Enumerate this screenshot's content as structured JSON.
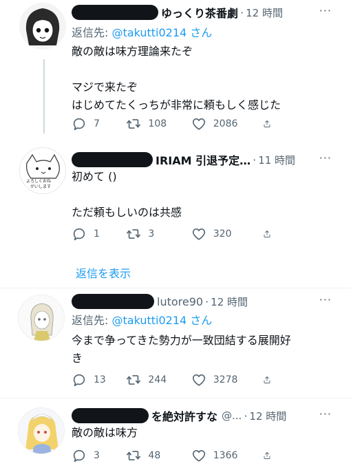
{
  "tweets": [
    {
      "name": "ゆっくり茶番劇",
      "handle": "",
      "time": "12 時間",
      "more": "···",
      "reply_to_label": "返信先:",
      "reply_to_handle": "@takutti0214 さん",
      "body": [
        "敵の敵は味方理論来たぞ",
        "マジで来たぞ",
        "はじめてたくっちが非常に頼もしく感じた"
      ],
      "replies": "7",
      "retweets": "108",
      "likes": "2086"
    },
    {
      "name": "IRIAM 引退予定…",
      "handle": "",
      "time": "11 時間",
      "more": "···",
      "body": [
        "初めて ()",
        "ただ頼もしいのは共感"
      ],
      "replies": "1",
      "retweets": "3",
      "likes": "320",
      "avatar_text_1": "よろしくおね",
      "avatar_text_2": "がいします"
    },
    {
      "name": "lutore90",
      "handle": "",
      "time": "12 時間",
      "more": "···",
      "reply_to_label": "返信先:",
      "reply_to_handle": "@takutti0214 さん",
      "body": [
        "今まで争ってきた勢力が一致団結する展開好",
        "き"
      ],
      "replies": "13",
      "retweets": "244",
      "likes": "3278"
    },
    {
      "name": "を絶対許すな",
      "handle": "@...",
      "time": "12 時間",
      "more": "···",
      "body": [
        "敵の敵は味方"
      ],
      "replies": "3",
      "retweets": "48",
      "likes": "1366"
    }
  ],
  "show_replies": "返信を表示",
  "icons": {
    "reply": "speech-bubble-icon",
    "retweet": "retweet-arrows-icon",
    "like": "heart-icon",
    "share": "share-upload-icon",
    "more": "ellipsis-icon"
  },
  "colors": {
    "link": "#1d9bf0",
    "secondary_text": "#536471",
    "primary_text": "#0f1419",
    "thread_line": "#cfd9de"
  }
}
